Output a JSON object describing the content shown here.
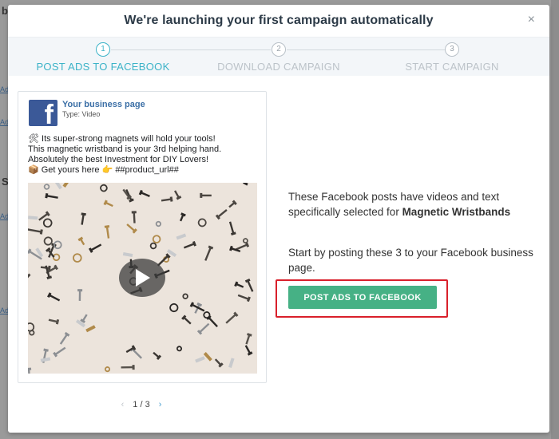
{
  "background": {
    "top_letter": "b",
    "mid_letter": "S",
    "link_texts": [
      "Ad",
      "Ad",
      "Ad",
      "Ad"
    ]
  },
  "modal": {
    "title": "We're launching your first campaign automatically",
    "close_glyph": "×"
  },
  "steps": [
    {
      "number": "1",
      "label": "POST ADS TO FACEBOOK",
      "active": true
    },
    {
      "number": "2",
      "label": "DOWNLOAD CAMPAIGN",
      "active": false
    },
    {
      "number": "3",
      "label": "START CAMPAIGN",
      "active": false
    }
  ],
  "post": {
    "page_name": "Your business page",
    "type_label": "Type: Video",
    "text_lines": [
      "🛠 Its super-strong magnets will hold your tools!",
      "This magnetic wristband is your 3rd helping hand.",
      "Absolutely the best Investment for DIY Lovers!",
      "📦 Get yours here 👉 ##product_url##"
    ]
  },
  "pager": {
    "prev": "‹",
    "current": "1 / 3",
    "next": "›"
  },
  "info": {
    "description_prefix": "These Facebook posts have videos and text specifically selected for ",
    "product_name": "Magnetic Wristbands",
    "instruction": "Start by posting these 3 to your Facebook business page.",
    "cta_label": "POST ADS TO FACEBOOK"
  },
  "colors": {
    "accent": "#3cb3c8",
    "cta": "#46b185",
    "highlight": "#d9202b",
    "facebook": "#3b5998"
  }
}
